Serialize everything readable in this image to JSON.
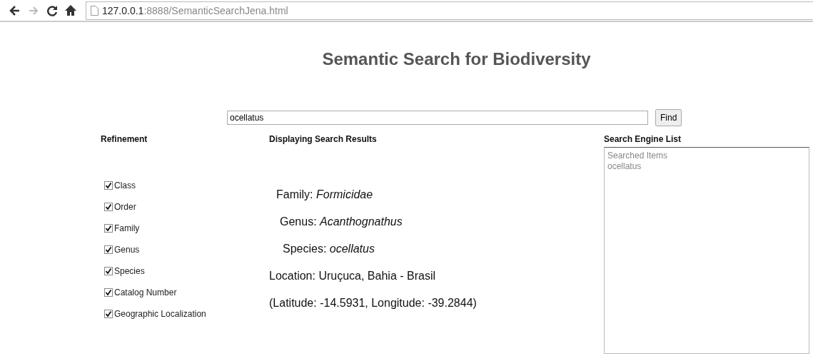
{
  "browser": {
    "url_host": "127.0.0.1",
    "url_path": ":8888/SemanticSearchJena.html"
  },
  "title": "Semantic Search for Biodiversity",
  "search": {
    "value": "ocellatus",
    "button": "Find"
  },
  "refinement": {
    "heading": "Refinement",
    "options": [
      {
        "label": "Class",
        "checked": true
      },
      {
        "label": "Order",
        "checked": true
      },
      {
        "label": "Family",
        "checked": true
      },
      {
        "label": "Genus",
        "checked": true
      },
      {
        "label": "Species",
        "checked": true
      },
      {
        "label": "Catalog Number",
        "checked": true
      },
      {
        "label": "Geographic Localization",
        "checked": true
      }
    ]
  },
  "results": {
    "heading": "Displaying Search Results",
    "lines": [
      "Family: *Formicidae*",
      "Genus: *Acanthognathus*",
      "Species: *ocellatus*",
      "Location: Uruçuca, Bahia - Brasil",
      "(Latitude: -14.5931, Longitude: -39.2844)"
    ]
  },
  "engine_list": {
    "heading": "Search Engine List",
    "lines": [
      "Searched Items",
      "ocellatus"
    ]
  }
}
